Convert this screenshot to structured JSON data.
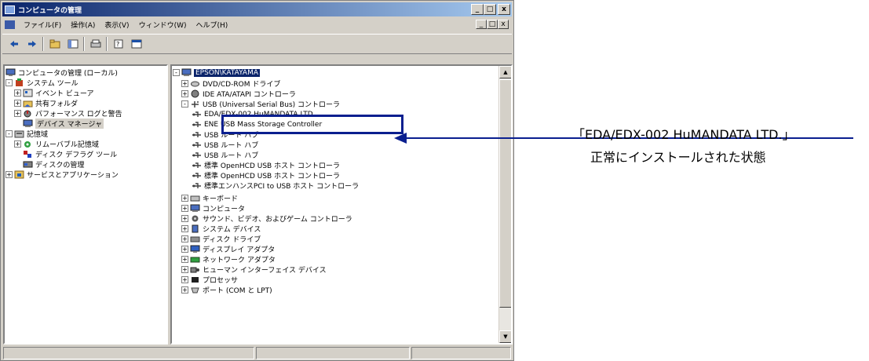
{
  "window": {
    "title": "コンピュータの管理",
    "controls": [
      "_",
      "□",
      "x"
    ]
  },
  "menu": {
    "items": [
      "ファイル(F)",
      "操作(A)",
      "表示(V)",
      "ウィンドウ(W)",
      "ヘルプ(H)"
    ]
  },
  "toolbar": {
    "icons": [
      "back-arrow-icon",
      "forward-arrow-icon",
      "up-folder-icon",
      "console-tree-icon",
      "print-icon",
      "properties-icon",
      "help-icon"
    ]
  },
  "left_tree": [
    {
      "label": "コンピュータの管理 (ローカル)",
      "expander": "none",
      "icon": "computer-management-icon"
    },
    {
      "label": "システム ツール",
      "expander": "-",
      "icon": "tools-icon"
    },
    {
      "label": "イベント ビューア",
      "expander": "+",
      "icon": "event-viewer-icon"
    },
    {
      "label": "共有フォルダ",
      "expander": "+",
      "icon": "shared-folder-icon"
    },
    {
      "label": "パフォーマンス ログと警告",
      "expander": "+",
      "icon": "performance-icon"
    },
    {
      "label": "デバイス マネージャ",
      "expander": "none",
      "icon": "device-manager-icon"
    },
    {
      "label": "記憶域",
      "expander": "-",
      "icon": "storage-icon"
    },
    {
      "label": "リムーバブル記憶域",
      "expander": "+",
      "icon": "removable-storage-icon"
    },
    {
      "label": "ディスク デフラグ ツール",
      "expander": "none",
      "icon": "defrag-icon"
    },
    {
      "label": "ディスクの管理",
      "expander": "none",
      "icon": "disk-management-icon"
    },
    {
      "label": "サービスとアプリケーション",
      "expander": "+",
      "icon": "services-icon"
    }
  ],
  "right_tree": [
    {
      "label": "EPSON\\KATAYAMA",
      "expander": "-",
      "icon": "computer-icon",
      "selected": true
    },
    {
      "label": "DVD/CD-ROM ドライブ",
      "expander": "+",
      "icon": "dvd-icon"
    },
    {
      "label": "IDE ATA/ATAPI コントローラ",
      "expander": "+",
      "icon": "ide-icon"
    },
    {
      "label": "USB (Universal Serial Bus) コントローラ",
      "expander": "-",
      "icon": "usb-icon"
    },
    {
      "label": "EDA/EDX-002 HuMANDATA LTD.",
      "expander": "none",
      "icon": "usb-device-icon"
    },
    {
      "label": "ENE USB Mass Storage Controller",
      "expander": "none",
      "icon": "usb-device-icon"
    },
    {
      "label": "USB ルート ハブ",
      "expander": "none",
      "icon": "usb-device-icon"
    },
    {
      "label": "USB ルート ハブ",
      "expander": "none",
      "icon": "usb-device-icon"
    },
    {
      "label": "USB ルート ハブ",
      "expander": "none",
      "icon": "usb-device-icon"
    },
    {
      "label": "標準 OpenHCD USB ホスト コントローラ",
      "expander": "none",
      "icon": "usb-device-icon"
    },
    {
      "label": "標準 OpenHCD USB ホスト コントローラ",
      "expander": "none",
      "icon": "usb-device-icon"
    },
    {
      "label": "標準エンハンスPCI to USB ホスト コントローラ",
      "expander": "none",
      "icon": "usb-device-icon"
    },
    {
      "label": "キーボード",
      "expander": "+",
      "icon": "keyboard-icon"
    },
    {
      "label": "コンピュータ",
      "expander": "+",
      "icon": "computer-icon"
    },
    {
      "label": "サウンド、ビデオ、およびゲーム コントローラ",
      "expander": "+",
      "icon": "sound-icon"
    },
    {
      "label": "システム デバイス",
      "expander": "+",
      "icon": "system-icon"
    },
    {
      "label": "ディスク ドライブ",
      "expander": "+",
      "icon": "disk-icon"
    },
    {
      "label": "ディスプレイ アダプタ",
      "expander": "+",
      "icon": "display-icon"
    },
    {
      "label": "ネットワーク アダプタ",
      "expander": "+",
      "icon": "network-icon"
    },
    {
      "label": "ヒューマン インターフェイス デバイス",
      "expander": "+",
      "icon": "hid-icon"
    },
    {
      "label": "プロセッサ",
      "expander": "+",
      "icon": "processor-icon"
    },
    {
      "label": "ポート (COM と LPT)",
      "expander": "+",
      "icon": "port-icon"
    }
  ],
  "annotation": {
    "line1": "「EDA/EDX-002 HuMANDATA LTD.」",
    "line2": "正常にインストールされた状態"
  },
  "colors": {
    "annotation_blue": "#0a1f8f",
    "title_blue": "#0a246a"
  }
}
